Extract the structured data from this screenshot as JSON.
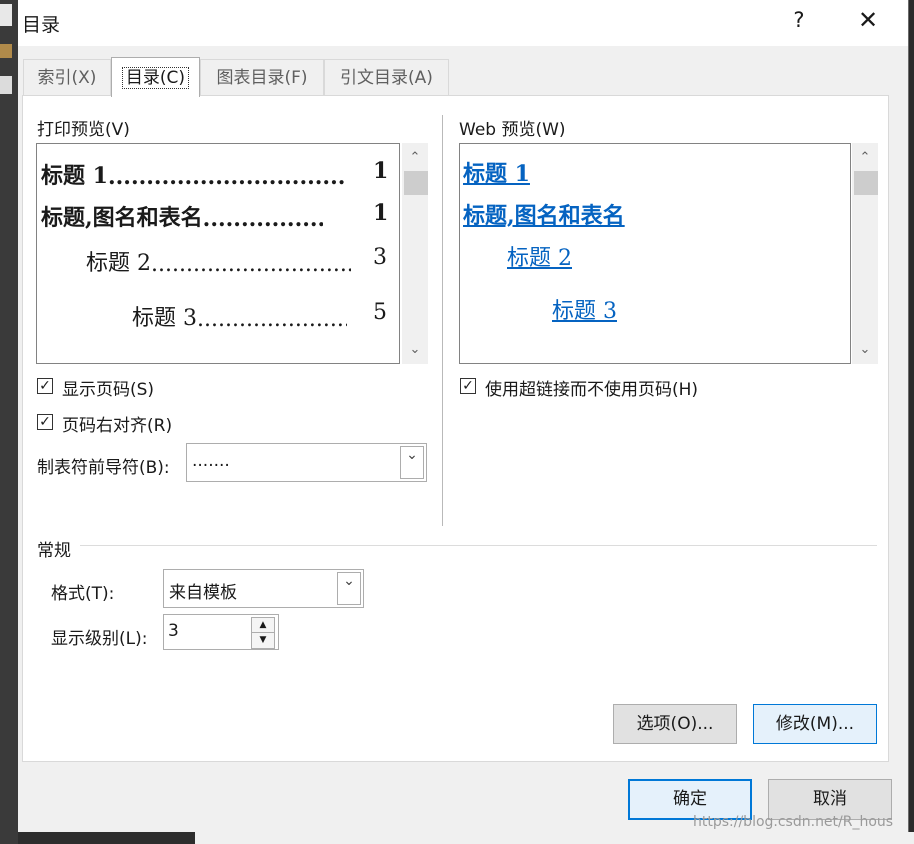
{
  "window": {
    "title": "目录",
    "help_glyph": "?",
    "close_glyph": "✕"
  },
  "tabs": [
    {
      "label": "索引(X)",
      "active": false
    },
    {
      "label": "目录(C)",
      "active": true
    },
    {
      "label": "图表目录(F)",
      "active": false
    },
    {
      "label": "引文目录(A)",
      "active": false
    }
  ],
  "print_preview": {
    "label": "打印预览(V)",
    "lines": [
      {
        "text": "标题 1",
        "page": "1"
      },
      {
        "text": "标题,图名和表名",
        "page": "1"
      },
      {
        "text": "标题 2",
        "page": "3"
      },
      {
        "text": "标题 3",
        "page": "5"
      }
    ]
  },
  "web_preview": {
    "label": "Web 预览(W)",
    "lines": [
      "标题 1",
      "标题,图名和表名",
      "标题 2",
      "标题 3"
    ]
  },
  "options": {
    "show_page_numbers": {
      "label": "显示页码(S)",
      "checked": true
    },
    "right_align": {
      "label": "页码右对齐(R)",
      "checked": true
    },
    "tab_leader": {
      "label": "制表符前导符(B):",
      "value": "......."
    },
    "use_hyperlinks": {
      "label": "使用超链接而不使用页码(H)",
      "checked": true
    }
  },
  "general": {
    "heading": "常规",
    "format": {
      "label": "格式(T):",
      "value": "来自模板"
    },
    "levels": {
      "label": "显示级别(L):",
      "value": "3"
    }
  },
  "buttons": {
    "options": "选项(O)...",
    "modify": "修改(M)...",
    "ok": "确定",
    "cancel": "取消"
  },
  "watermark": "https://blog.csdn.net/R_hous",
  "icons": {
    "check": "✓",
    "chevron_down": "⌄",
    "chevron_up": "⌃",
    "spin_up": "▲",
    "spin_down": "▼"
  }
}
